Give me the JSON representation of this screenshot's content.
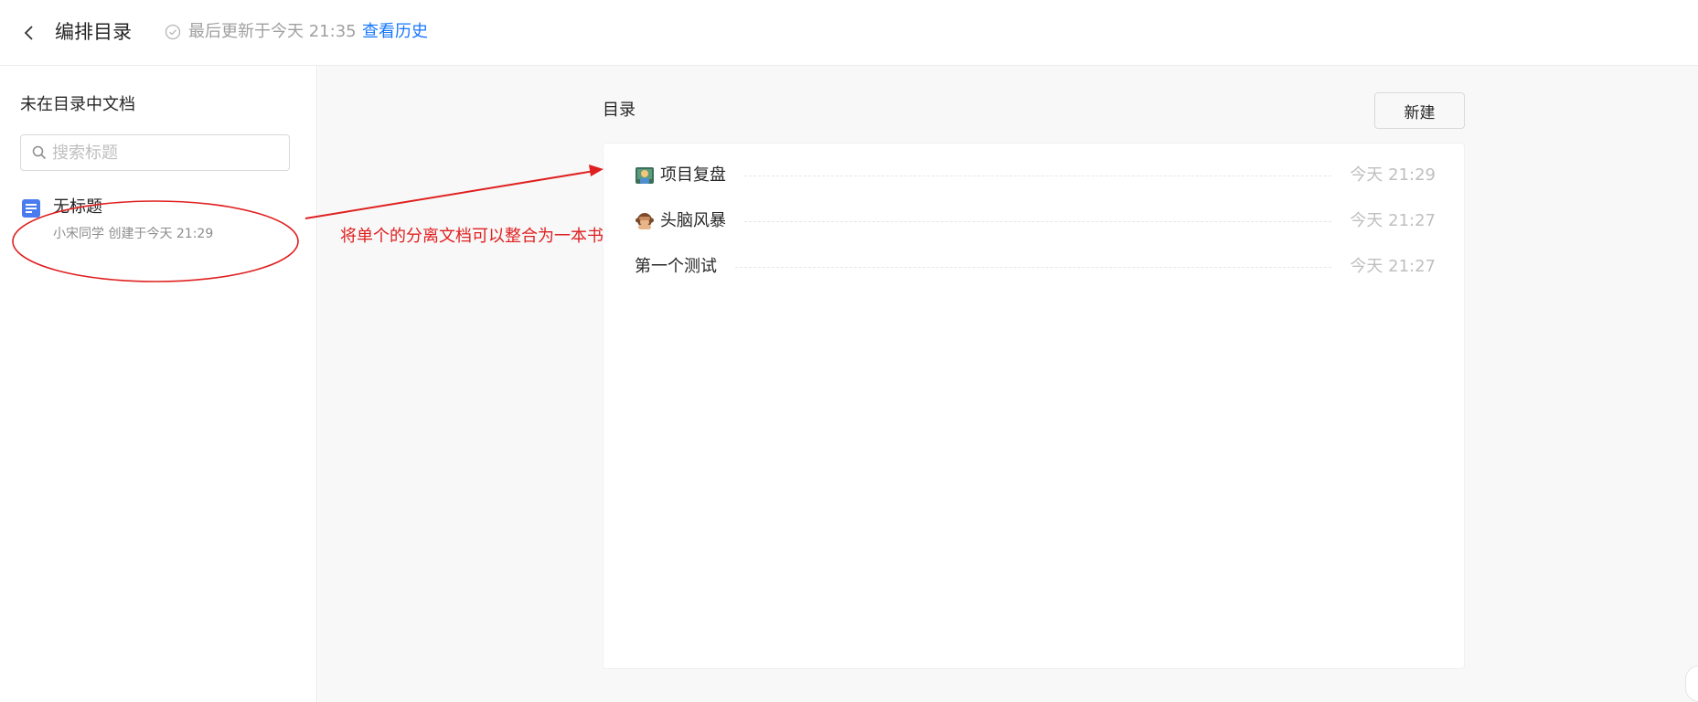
{
  "header": {
    "title": "编排目录",
    "status": "最后更新于今天 21:35",
    "history_link": "查看历史"
  },
  "sidebar": {
    "title": "未在目录中文档",
    "search_placeholder": "搜索标题",
    "documents": [
      {
        "title": "无标题",
        "meta": "小宋同学 创建于今天 21:29"
      }
    ]
  },
  "main": {
    "toc_label": "目录",
    "new_button": "新建",
    "toc_items": [
      {
        "emoji": "teacher-emoji",
        "name": "项目复盘",
        "time": "今天 21:29"
      },
      {
        "emoji": "monkey-emoji",
        "name": "头脑风暴",
        "time": "今天 21:27"
      },
      {
        "emoji": "",
        "name": "第一个测试",
        "time": "今天 21:27"
      }
    ]
  },
  "annotation": {
    "text": "将单个的分离文档可以整合为一本书",
    "color": "#e02020"
  },
  "colors": {
    "link": "#1677ff",
    "doc_icon": "#4a7cf0"
  }
}
